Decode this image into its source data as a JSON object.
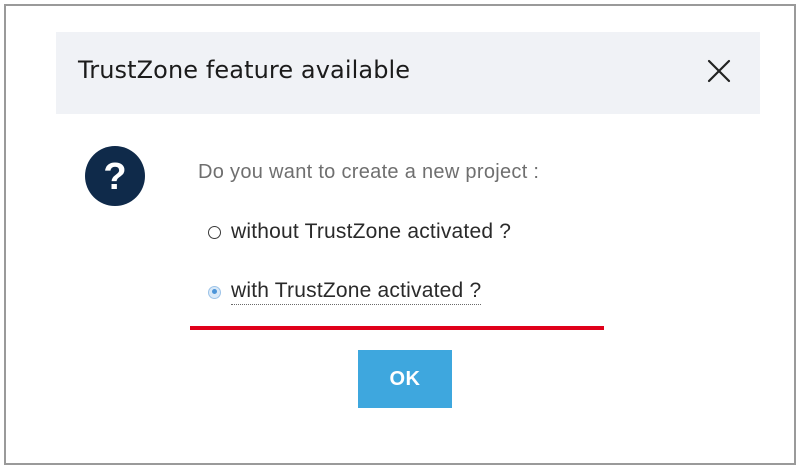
{
  "dialog": {
    "title": "TrustZone feature available",
    "close_icon": "close-icon",
    "question_icon": "question-mark-icon",
    "question": "Do you want to create a new project :",
    "options": [
      {
        "label": "without TrustZone activated ?",
        "selected": false
      },
      {
        "label": "with TrustZone activated ?",
        "selected": true
      }
    ],
    "ok_label": "OK"
  },
  "colors": {
    "titlebar_bg": "#f0f2f6",
    "accent_button": "#3ea7de",
    "question_icon_bg": "#0f2a4a",
    "annotation_underline": "#e0001a"
  }
}
